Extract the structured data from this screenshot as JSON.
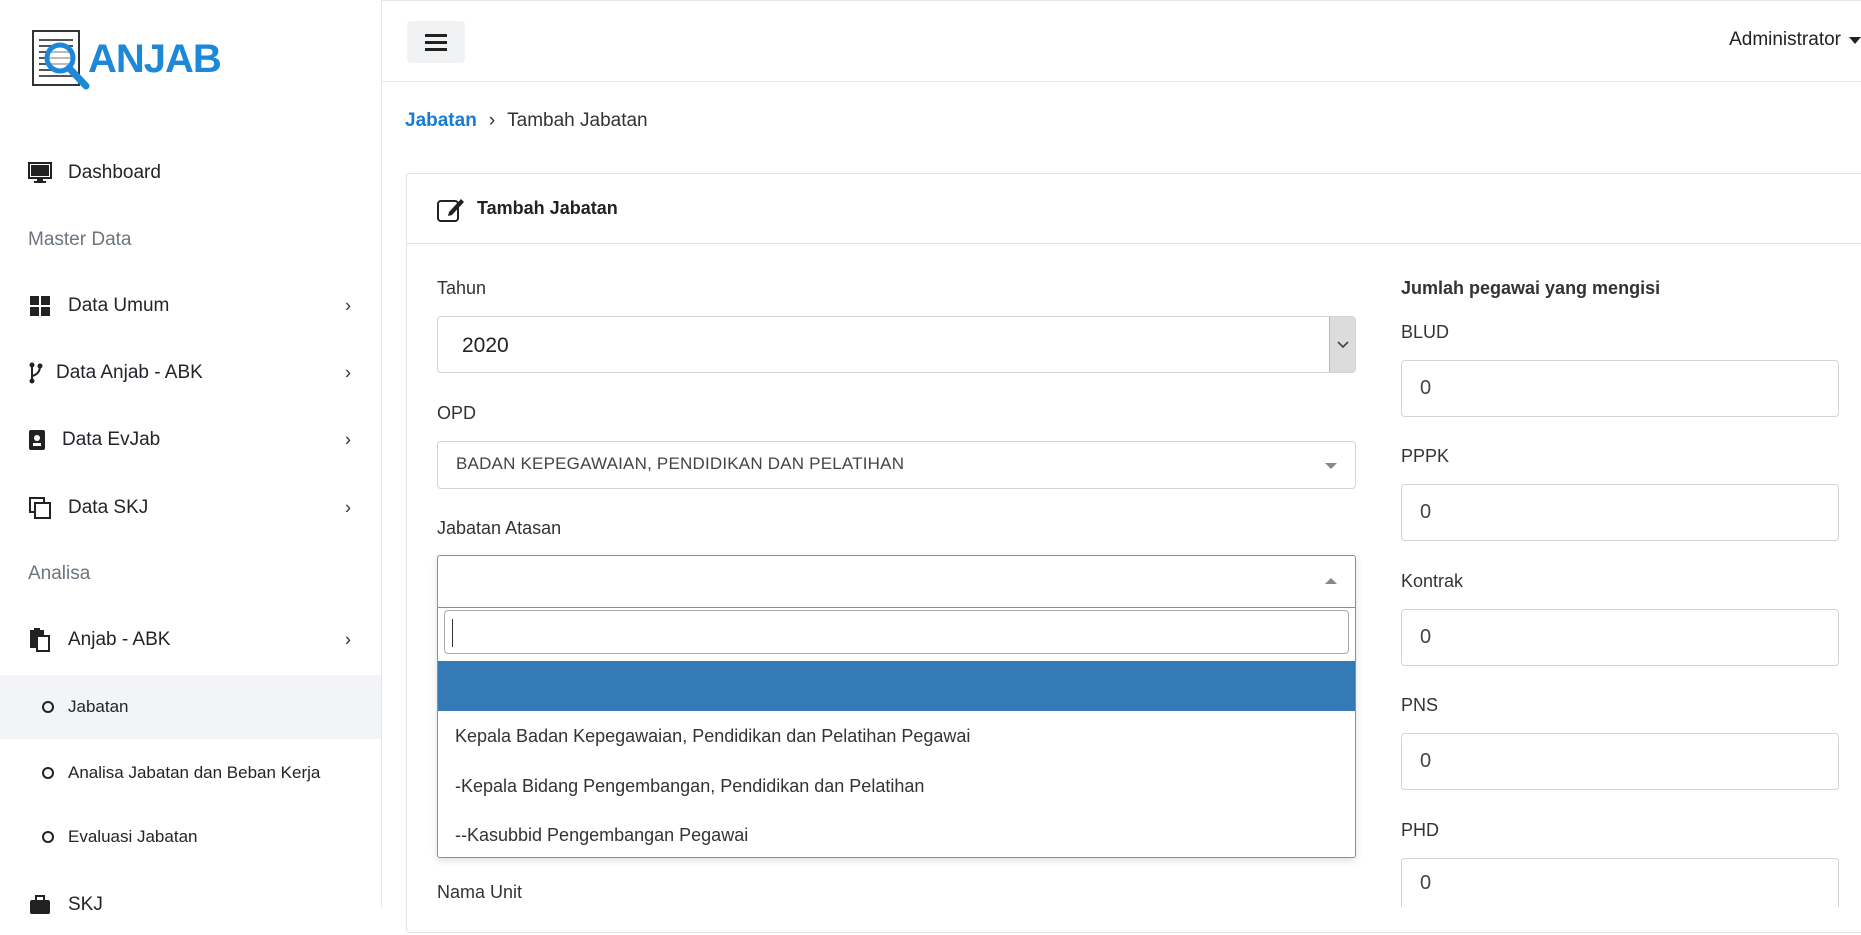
{
  "app": {
    "logo_text": "ANJAB"
  },
  "sidebar": {
    "dashboard": "Dashboard",
    "section_master": "Master Data",
    "data_umum": "Data Umum",
    "data_anjab_abk": "Data Anjab - ABK",
    "data_evjab": "Data EvJab",
    "data_skj": "Data SKJ",
    "section_analisa": "Analisa",
    "anjab_abk": "Anjab - ABK",
    "sub_jabatan": "Jabatan",
    "sub_analisa": "Analisa Jabatan dan Beban Kerja",
    "sub_evaluasi": "Evaluasi Jabatan",
    "skj": "SKJ"
  },
  "topbar": {
    "user": "Administrator"
  },
  "breadcrumb": {
    "parent": "Jabatan",
    "separator": "›",
    "current": "Tambah Jabatan"
  },
  "card": {
    "title": "Tambah Jabatan"
  },
  "form": {
    "tahun_label": "Tahun",
    "tahun_value": "2020",
    "opd_label": "OPD",
    "opd_value": "BADAN KEPEGAWAIAN, PENDIDIKAN DAN PELATIHAN",
    "atasan_label": "Jabatan Atasan",
    "nama_unit_label": "Nama Unit",
    "dropdown_options": [
      "Kepala Badan Kepegawaian, Pendidikan dan Pelatihan Pegawai",
      "-Kepala Bidang Pengembangan, Pendidikan dan Pelatihan",
      "--Kasubbid Pengembangan Pegawai"
    ]
  },
  "pegawai": {
    "heading": "Jumlah pegawai yang mengisi",
    "blud_label": "BLUD",
    "blud_value": "0",
    "pppk_label": "PPPK",
    "pppk_value": "0",
    "kontrak_label": "Kontrak",
    "kontrak_value": "0",
    "pns_label": "PNS",
    "pns_value": "0",
    "phd_label": "PHD",
    "phd_value": "0"
  }
}
